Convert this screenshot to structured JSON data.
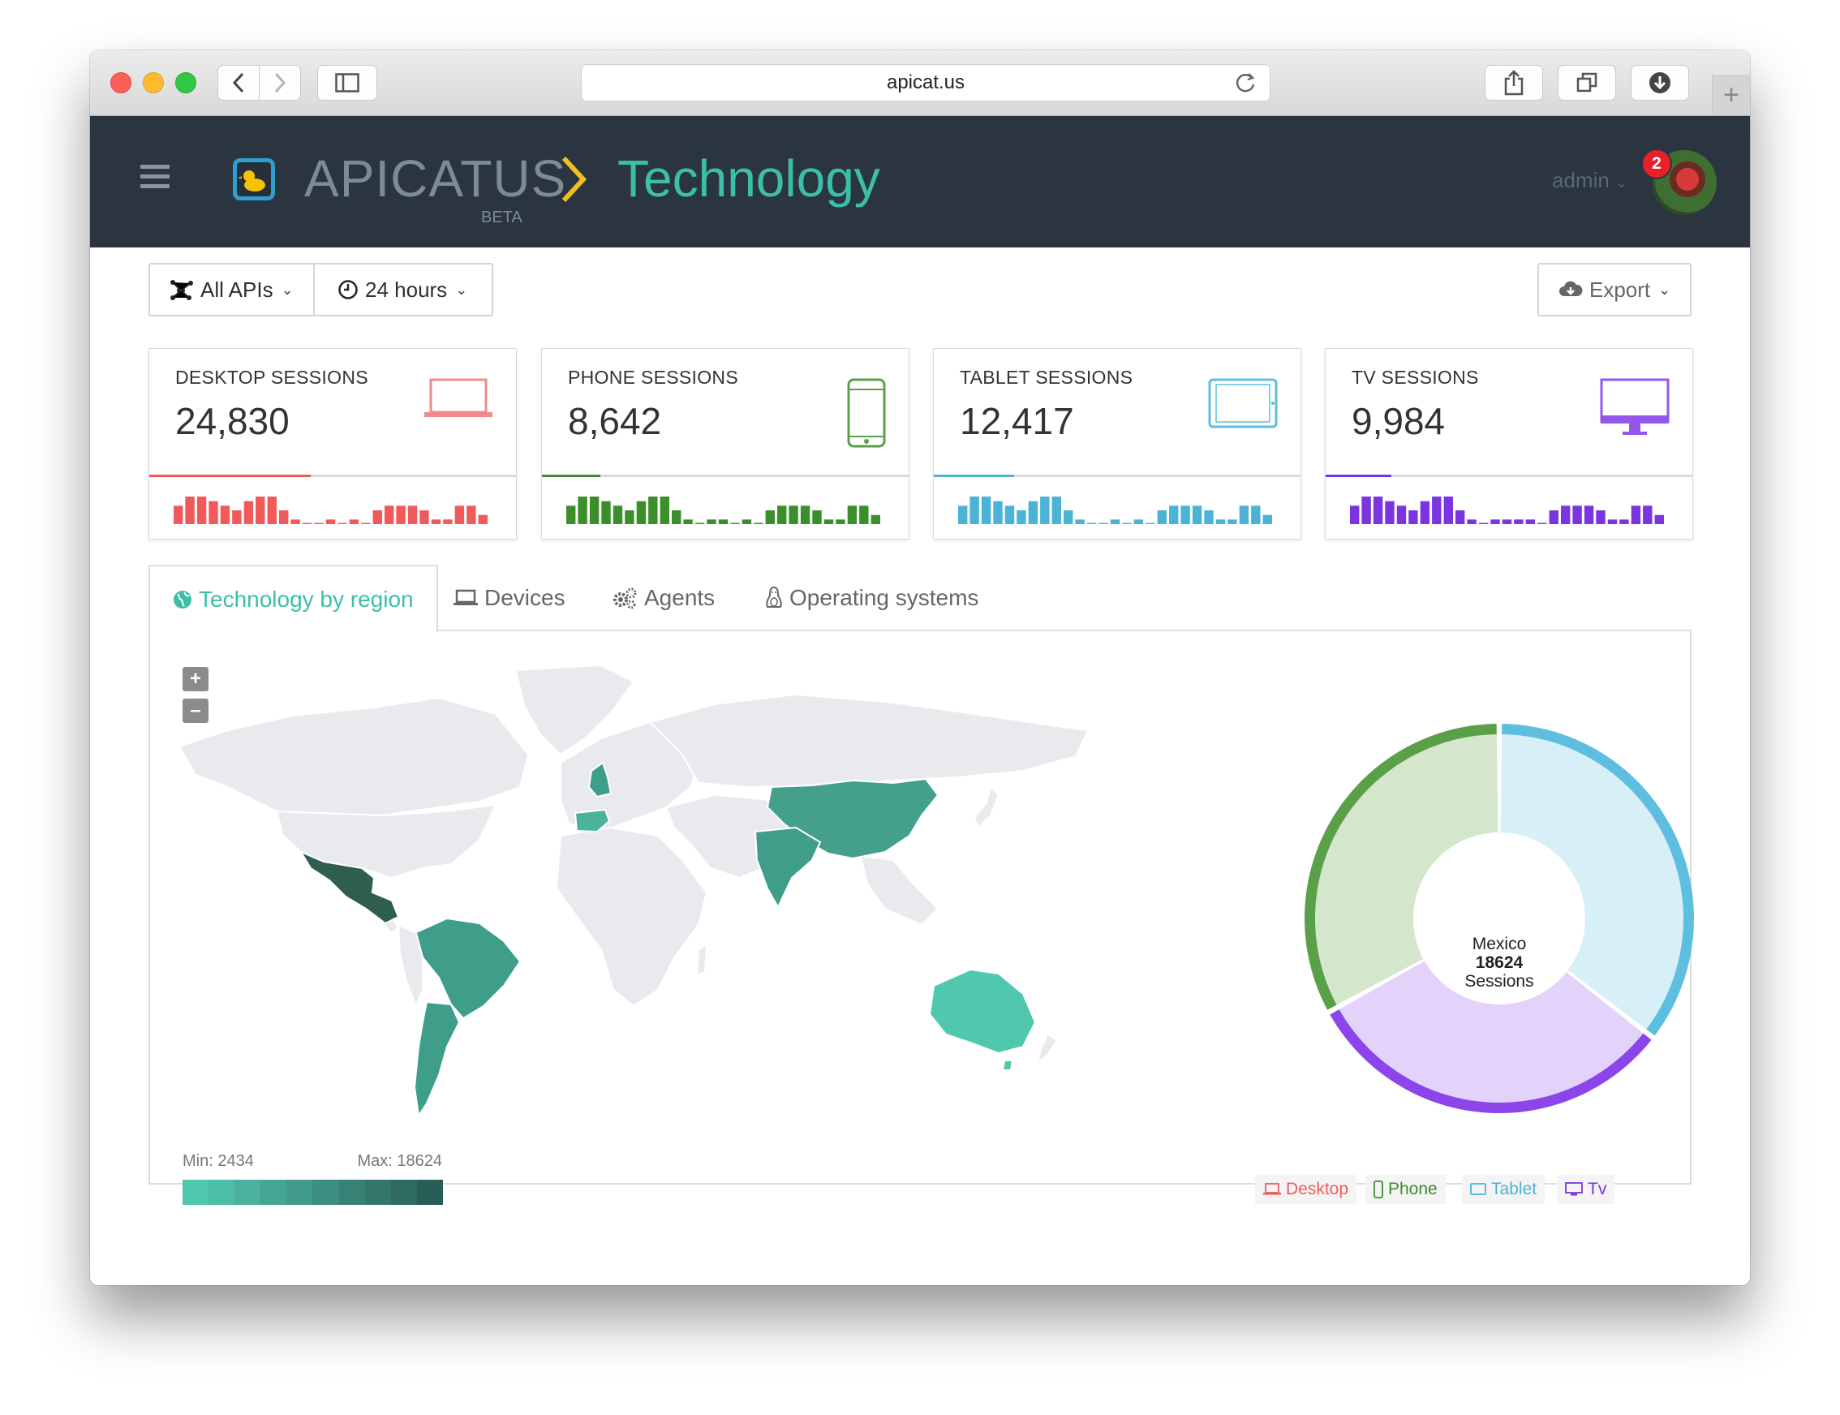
{
  "browser": {
    "url": "apicat.us"
  },
  "header": {
    "brand": "APICATUS",
    "beta": "BETA",
    "section": "Technology",
    "user": "admin",
    "notifications": "2"
  },
  "toolbar": {
    "apis": "All APIs",
    "range": "24 hours",
    "export": "Export"
  },
  "cards": [
    {
      "title": "DESKTOP SESSIONS",
      "value": "24,830",
      "color": "#f05a5a",
      "progress": 0.44,
      "bars": [
        4,
        6,
        6,
        5,
        4,
        3,
        5,
        6,
        6,
        3,
        1,
        0,
        0,
        1,
        0,
        1,
        0,
        3,
        4,
        4,
        4,
        3,
        1,
        1,
        4,
        4,
        2
      ]
    },
    {
      "title": "PHONE SESSIONS",
      "value": "8,642",
      "color": "#3a8f2b",
      "progress": 0.16,
      "bars": [
        4,
        6,
        6,
        5,
        4,
        3,
        5,
        6,
        6,
        3,
        1,
        0,
        1,
        1,
        0,
        1,
        0,
        3,
        4,
        4,
        4,
        3,
        1,
        1,
        4,
        4,
        2
      ]
    },
    {
      "title": "TABLET SESSIONS",
      "value": "12,417",
      "color": "#4ab3d6",
      "progress": 0.22,
      "bars": [
        4,
        6,
        6,
        5,
        4,
        3,
        5,
        6,
        6,
        3,
        1,
        0,
        0,
        1,
        0,
        1,
        0,
        3,
        4,
        4,
        4,
        3,
        1,
        1,
        4,
        4,
        2
      ]
    },
    {
      "title": "TV SESSIONS",
      "value": "9,984",
      "color": "#7b35e0",
      "progress": 0.18,
      "bars": [
        4,
        6,
        6,
        5,
        4,
        3,
        5,
        6,
        6,
        3,
        1,
        0,
        1,
        1,
        1,
        1,
        0,
        3,
        4,
        4,
        4,
        3,
        1,
        1,
        4,
        4,
        2
      ]
    }
  ],
  "tabs": [
    {
      "label": "Technology by region",
      "icon": "globe-icon"
    },
    {
      "label": "Devices",
      "icon": "laptop-icon"
    },
    {
      "label": "Agents",
      "icon": "gears-icon"
    },
    {
      "label": "Operating systems",
      "icon": "linux-icon"
    }
  ],
  "map": {
    "min_label": "Min: 2434",
    "max_label": "Max: 18624",
    "zoom_in": "+",
    "zoom_out": "–",
    "scale_colors": [
      "#4fc8ae",
      "#4cbda6",
      "#49b19d",
      "#45a593",
      "#419a8a",
      "#3c8e80",
      "#388275",
      "#33766b",
      "#2e6a60",
      "#295e56"
    ]
  },
  "donut": {
    "country": "Mexico",
    "sessions": "18624",
    "sessions_label": "Sessions",
    "segments": [
      {
        "name": "Tablet",
        "fraction": 0.355,
        "color": "#5ebedf",
        "fill": "#d7eff6"
      },
      {
        "name": "Tv",
        "fraction": 0.315,
        "color": "#8b45ea",
        "fill": "#e3d2fa"
      },
      {
        "name": "Phone",
        "fraction": 0.33,
        "color": "#5aa048",
        "fill": "#d4e7cc"
      }
    ]
  },
  "legend": [
    {
      "label": "Desktop",
      "color": "#f05a5a"
    },
    {
      "label": "Phone",
      "color": "#3a8f2b"
    },
    {
      "label": "Tablet",
      "color": "#4ab3d6"
    },
    {
      "label": "Tv",
      "color": "#7b35e0"
    }
  ]
}
